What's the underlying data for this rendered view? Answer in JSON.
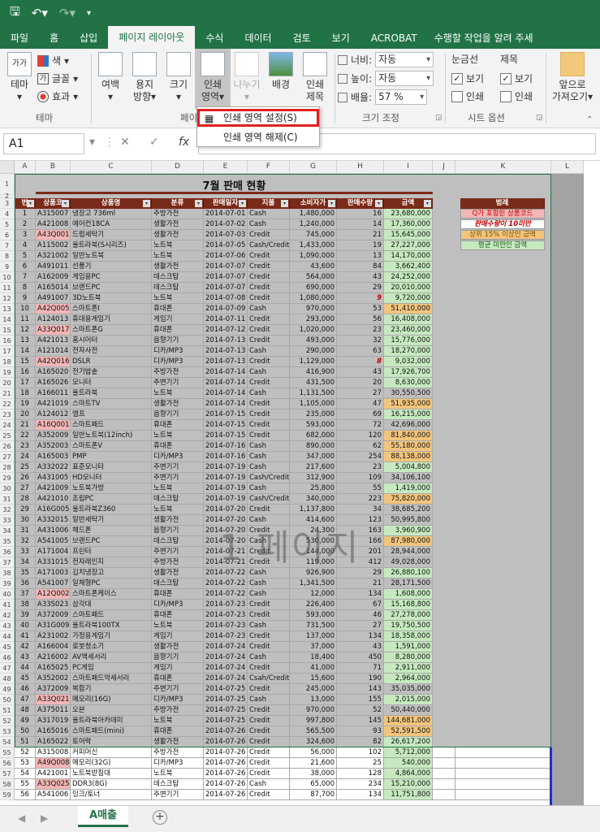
{
  "ribbon_tabs": [
    "파일",
    "홈",
    "삽입",
    "페이지 레이아웃",
    "수식",
    "데이터",
    "검토",
    "보기",
    "ACROBAT",
    "수행할 작업을 알려 주세"
  ],
  "ribbon": {
    "theme": {
      "label": "테마",
      "colors": "색",
      "fonts": "글꼴",
      "effects": "효과",
      "group": "테마"
    },
    "margins": "여백",
    "orientation": [
      "용지",
      "방향"
    ],
    "size": "크기",
    "print_area": [
      "인쇄",
      "영역"
    ],
    "breaks": "나누기",
    "background": "배경",
    "print_titles": [
      "인쇄",
      "제목"
    ],
    "group_page": "페이",
    "scale": {
      "width_label": "너비:",
      "width": "자동",
      "height_label": "높이:",
      "height": "자동",
      "scale_label": "배율:",
      "scale": "57 %",
      "group": "크기 조정"
    },
    "sheet_options": {
      "gridlines": "눈금선",
      "headings": "제목",
      "view": "보기",
      "print": "인쇄",
      "group": "시트 옵션"
    },
    "bring_forward": [
      "앞으로",
      "가져오기"
    ]
  },
  "dropdown": {
    "set": "인쇄 영역 설정(S)",
    "clear": "인쇄 영역 해제(C)"
  },
  "namebox": "A1",
  "formula_label": "fx",
  "columns": [
    "A",
    "B",
    "C",
    "D",
    "E",
    "F",
    "G",
    "H",
    "I",
    "J",
    "K",
    "L"
  ],
  "title": "7월 판매 현황",
  "headers": [
    "번",
    "상품코",
    "상품명",
    "분류",
    "판매일자",
    "지불",
    "소비자가",
    "판매수량",
    "금액"
  ],
  "legend": {
    "title": "범례",
    "items": [
      "Q가 포함된 상품코드",
      "판매수량이 10미만",
      "상위 15% 이상인 금액",
      "평균 미만인 금액"
    ]
  },
  "watermark": "1 페이지",
  "sheet_tab": "A매출",
  "rows": [
    [
      "1",
      "A315007",
      "냉장고 736ml",
      "주방가전",
      "2014-07-01",
      "Cash",
      "1,480,000",
      "16",
      "23,680,000"
    ],
    [
      "2",
      "A421008",
      "에어컨18CA",
      "생활가전",
      "2014-07-02",
      "Cash",
      "1,240,000",
      "14",
      "17,360,000"
    ],
    [
      "3",
      "A43Q001",
      "드럼세탁기",
      "생활가전",
      "2014-07-03",
      "Credit",
      "745,000",
      "21",
      "15,645,000"
    ],
    [
      "4",
      "A115002",
      "울트라북(S시리즈)",
      "노트북",
      "2014-07-05",
      "Cash/Credit",
      "1,433,000",
      "19",
      "27,227,000"
    ],
    [
      "5",
      "A321002",
      "일반노트북",
      "노트북",
      "2014-07-06",
      "Credit",
      "1,090,000",
      "13",
      "14,170,000"
    ],
    [
      "6",
      "A491011",
      "선풍기",
      "생활가전",
      "2014-07-07",
      "Credit",
      "43,600",
      "84",
      "3,662,400"
    ],
    [
      "7",
      "A162009",
      "게임용PC",
      "데스크탑",
      "2014-07-07",
      "Credit",
      "564,000",
      "43",
      "24,252,000"
    ],
    [
      "8",
      "A165014",
      "브랜드PC",
      "데스크탑",
      "2014-07-07",
      "Credit",
      "690,000",
      "29",
      "20,010,000"
    ],
    [
      "9",
      "A491007",
      "3D노트북",
      "노트북",
      "2014-07-08",
      "Credit",
      "1,080,000",
      "9",
      "9,720,000"
    ],
    [
      "10",
      "A42Q005",
      "스마트폰I",
      "휴대폰",
      "2014-07-09",
      "Cash",
      "970,000",
      "53",
      "51,410,000"
    ],
    [
      "11",
      "A124013",
      "휴대용게임기",
      "게임기",
      "2014-07-11",
      "Credit",
      "293,000",
      "56",
      "16,408,000"
    ],
    [
      "12",
      "A33Q017",
      "스마트폰G",
      "휴대폰",
      "2014-07-12",
      "Credit",
      "1,020,000",
      "23",
      "23,460,000"
    ],
    [
      "13",
      "A421013",
      "홈시어터",
      "음향기기",
      "2014-07-13",
      "Credit",
      "493,000",
      "32",
      "15,776,000"
    ],
    [
      "14",
      "A121014",
      "전자사전",
      "디카/MP3",
      "2014-07-13",
      "Cash",
      "290,000",
      "63",
      "18,270,000"
    ],
    [
      "15",
      "A42Q016",
      "DSLR",
      "디카/MP3",
      "2014-07-13",
      "Credit",
      "1,129,000",
      "8",
      "9,032,000"
    ],
    [
      "16",
      "A165020",
      "전기밥솥",
      "주방가전",
      "2014-07-14",
      "Cash",
      "416,900",
      "43",
      "17,926,700"
    ],
    [
      "17",
      "A165026",
      "모니터",
      "주변기기",
      "2014-07-14",
      "Credit",
      "431,500",
      "20",
      "8,630,000"
    ],
    [
      "18",
      "A166011",
      "울트라북",
      "노트북",
      "2014-07-14",
      "Cash",
      "1,131,500",
      "27",
      "30,550,500"
    ],
    [
      "19",
      "A421019",
      "스마트TV",
      "생활가전",
      "2014-07-14",
      "Credit",
      "1,105,000",
      "47",
      "51,935,000"
    ],
    [
      "20",
      "A124012",
      "앰프",
      "음향기기",
      "2014-07-15",
      "Credit",
      "235,000",
      "69",
      "16,215,000"
    ],
    [
      "21",
      "A16Q001",
      "스마트패드",
      "휴대폰",
      "2014-07-15",
      "Credit",
      "593,000",
      "72",
      "42,696,000"
    ],
    [
      "22",
      "A352009",
      "일반노트북(12inch)",
      "노트북",
      "2014-07-15",
      "Credit",
      "682,000",
      "120",
      "81,840,000"
    ],
    [
      "23",
      "A352003",
      "스마트폰V",
      "휴대폰",
      "2014-07-16",
      "Cash",
      "890,000",
      "62",
      "55,180,000"
    ],
    [
      "24",
      "A165003",
      "PMP",
      "디카/MP3",
      "2014-07-16",
      "Cash",
      "347,000",
      "254",
      "88,138,000"
    ],
    [
      "25",
      "A332022",
      "표준모니터",
      "주변기기",
      "2014-07-19",
      "Cash",
      "217,600",
      "23",
      "5,004,800"
    ],
    [
      "26",
      "A431005",
      "HD모니터",
      "주변기기",
      "2014-07-19",
      "Cash/Credit",
      "312,900",
      "109",
      "34,106,100"
    ],
    [
      "27",
      "A421009",
      "노트북가방",
      "노트북",
      "2014-07-19",
      "Cash",
      "25,800",
      "55",
      "1,419,000"
    ],
    [
      "28",
      "A421010",
      "조립PC",
      "데스크탑",
      "2014-07-19",
      "Cash/Credit",
      "340,000",
      "223",
      "75,820,000"
    ],
    [
      "29",
      "A16G005",
      "울트라북Z360",
      "노트북",
      "2014-07-20",
      "Credit",
      "1,137,800",
      "34",
      "38,685,200"
    ],
    [
      "30",
      "A332015",
      "일반세탁기",
      "생활가전",
      "2014-07-20",
      "Cash",
      "414,600",
      "123",
      "50,995,800"
    ],
    [
      "31",
      "A431006",
      "헤드폰",
      "음향기기",
      "2014-07-20",
      "Credit",
      "24,300",
      "163",
      "3,960,900"
    ],
    [
      "32",
      "A541005",
      "브랜드PC",
      "데스크탑",
      "2014-07-20",
      "Cash",
      "530,000",
      "166",
      "87,980,000"
    ],
    [
      "33",
      "A171004",
      "프린터",
      "주변기기",
      "2014-07-21",
      "Credit",
      "144,000",
      "201",
      "28,944,000"
    ],
    [
      "34",
      "A331015",
      "전자레인지",
      "주방가전",
      "2014-07-21",
      "Credit",
      "119,000",
      "412",
      "49,028,000"
    ],
    [
      "35",
      "A171003",
      "김치냉장고",
      "생활가전",
      "2014-07-22",
      "Cash",
      "926,900",
      "29",
      "26,880,100"
    ],
    [
      "36",
      "A541007",
      "일체형PC",
      "데스크탑",
      "2014-07-22",
      "Cash",
      "1,341,500",
      "21",
      "28,171,500"
    ],
    [
      "37",
      "A12Q002",
      "스마트폰케이스",
      "휴대폰",
      "2014-07-22",
      "Cash",
      "12,000",
      "134",
      "1,608,000"
    ],
    [
      "38",
      "A33S023",
      "삼각대",
      "디카/MP3",
      "2014-07-23",
      "Credit",
      "226,400",
      "67",
      "15,168,800"
    ],
    [
      "39",
      "A372009",
      "스마트패드",
      "휴대폰",
      "2014-07-23",
      "Credit",
      "593,000",
      "46",
      "27,278,000"
    ],
    [
      "40",
      "A31G009",
      "울트라북100TX",
      "노트북",
      "2014-07-23",
      "Cash",
      "731,500",
      "27",
      "19,750,500"
    ],
    [
      "41",
      "A231002",
      "가정용게임기",
      "게임기",
      "2014-07-23",
      "Credit",
      "137,000",
      "134",
      "18,358,000"
    ],
    [
      "42",
      "A166004",
      "로봇청소기",
      "생활가전",
      "2014-07-24",
      "Credit",
      "37,000",
      "43",
      "1,591,000"
    ],
    [
      "43",
      "A216002",
      "AV액세서리",
      "음향기기",
      "2014-07-24",
      "Cash",
      "18,400",
      "450",
      "8,280,000"
    ],
    [
      "44",
      "A165025",
      "PC게임",
      "게임기",
      "2014-07-24",
      "Credit",
      "41,000",
      "71",
      "2,911,000"
    ],
    [
      "45",
      "A352002",
      "스마트패드악세서리",
      "휴대폰",
      "2014-07-24",
      "Csah/Credit",
      "15,600",
      "190",
      "2,964,000"
    ],
    [
      "46",
      "A372009",
      "복합기",
      "주변기기",
      "2014-07-25",
      "Credit",
      "245,000",
      "143",
      "35,035,000"
    ],
    [
      "47",
      "A33Q021",
      "메모리(16G)",
      "디카/MP3",
      "2014-07-25",
      "Cash",
      "13,000",
      "155",
      "2,015,000"
    ],
    [
      "48",
      "A375011",
      "오븐",
      "주방가전",
      "2014-07-25",
      "Credit",
      "970,000",
      "52",
      "50,440,000"
    ],
    [
      "49",
      "A317019",
      "울트라북아카데미",
      "노트북",
      "2014-07-25",
      "Credit",
      "997,800",
      "145",
      "144,681,000"
    ],
    [
      "50",
      "A165016",
      "스마트패드(mini)",
      "휴대폰",
      "2014-07-26",
      "Credit",
      "565,500",
      "93",
      "52,591,500"
    ],
    [
      "51",
      "A165022",
      "토어락",
      "생활가전",
      "2014-07-26",
      "Credit",
      "324,600",
      "82",
      "26,617,200"
    ],
    [
      "52",
      "A315008",
      "커피머신",
      "주방가전",
      "2014-07-26",
      "Credit",
      "56,000",
      "102",
      "5,712,000"
    ],
    [
      "53",
      "A49Q008",
      "메모리(32G)",
      "디카/MP3",
      "2014-07-26",
      "Credit",
      "21,600",
      "25",
      "540,000"
    ],
    [
      "54",
      "A421001",
      "노트북받침대",
      "노트북",
      "2014-07-26",
      "Credit",
      "38,000",
      "128",
      "4,864,000"
    ],
    [
      "55",
      "A33Q025",
      "DDR3(8G)",
      "데스크탑",
      "2014-07-26",
      "Cash",
      "65,000",
      "234",
      "15,210,000"
    ],
    [
      "56",
      "A541006",
      "잉크/토너",
      "주변기기",
      "2014-07-26",
      "Credit",
      "87,700",
      "134",
      "11,751,800"
    ]
  ],
  "colors": {
    "brand": "#217346",
    "header": "#7a2a18",
    "q_code": "#f4b6b6",
    "low_qty": "#c00000",
    "top_amount": "#f2c57c",
    "below_avg": "#c6e9c0"
  }
}
